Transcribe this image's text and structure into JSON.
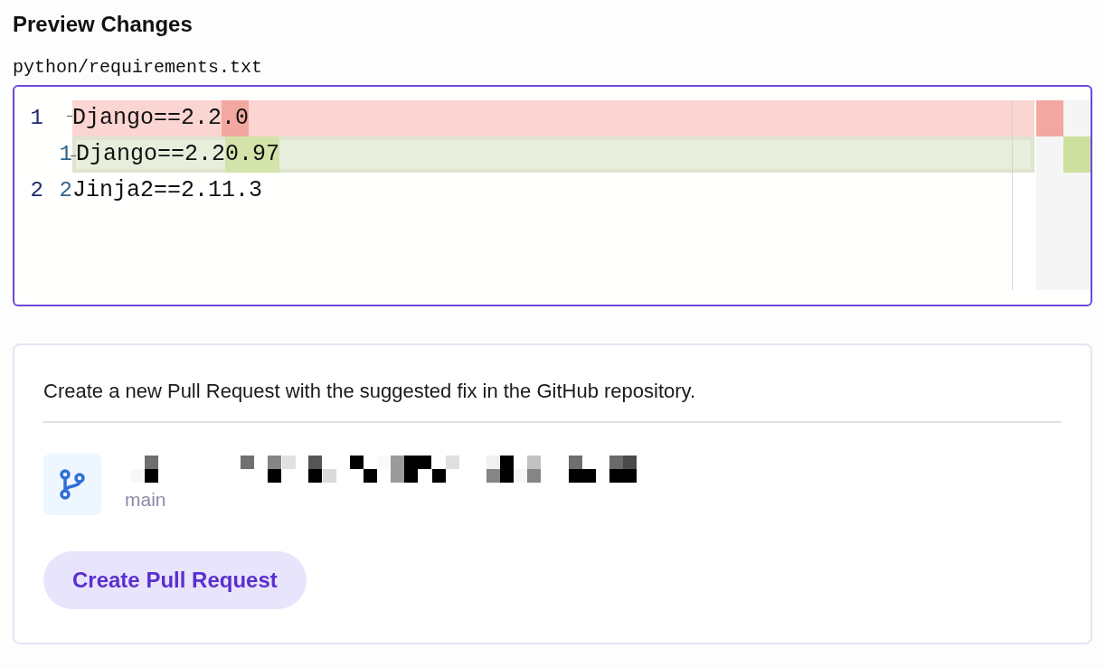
{
  "title": "Preview Changes",
  "file_path": "python/requirements.txt",
  "diff": {
    "lines": [
      {
        "kind": "removed",
        "old_number": "1",
        "segments": [
          {
            "text": "Django==2.2",
            "changed": false
          },
          {
            "text": ".0",
            "changed": true
          }
        ]
      },
      {
        "kind": "added",
        "new_number": "1",
        "segments": [
          {
            "text": "Django==2.2",
            "changed": false
          },
          {
            "text": "0.97",
            "changed": true
          }
        ]
      },
      {
        "kind": "context",
        "old_number": "2",
        "new_number": "2",
        "segments": [
          {
            "text": "Jinja2==2.11.3"
          }
        ]
      }
    ]
  },
  "pull_request": {
    "description": "Create a new Pull Request with the suggested fix in the GitHub repository.",
    "branch": "main",
    "button": "Create Pull Request"
  }
}
